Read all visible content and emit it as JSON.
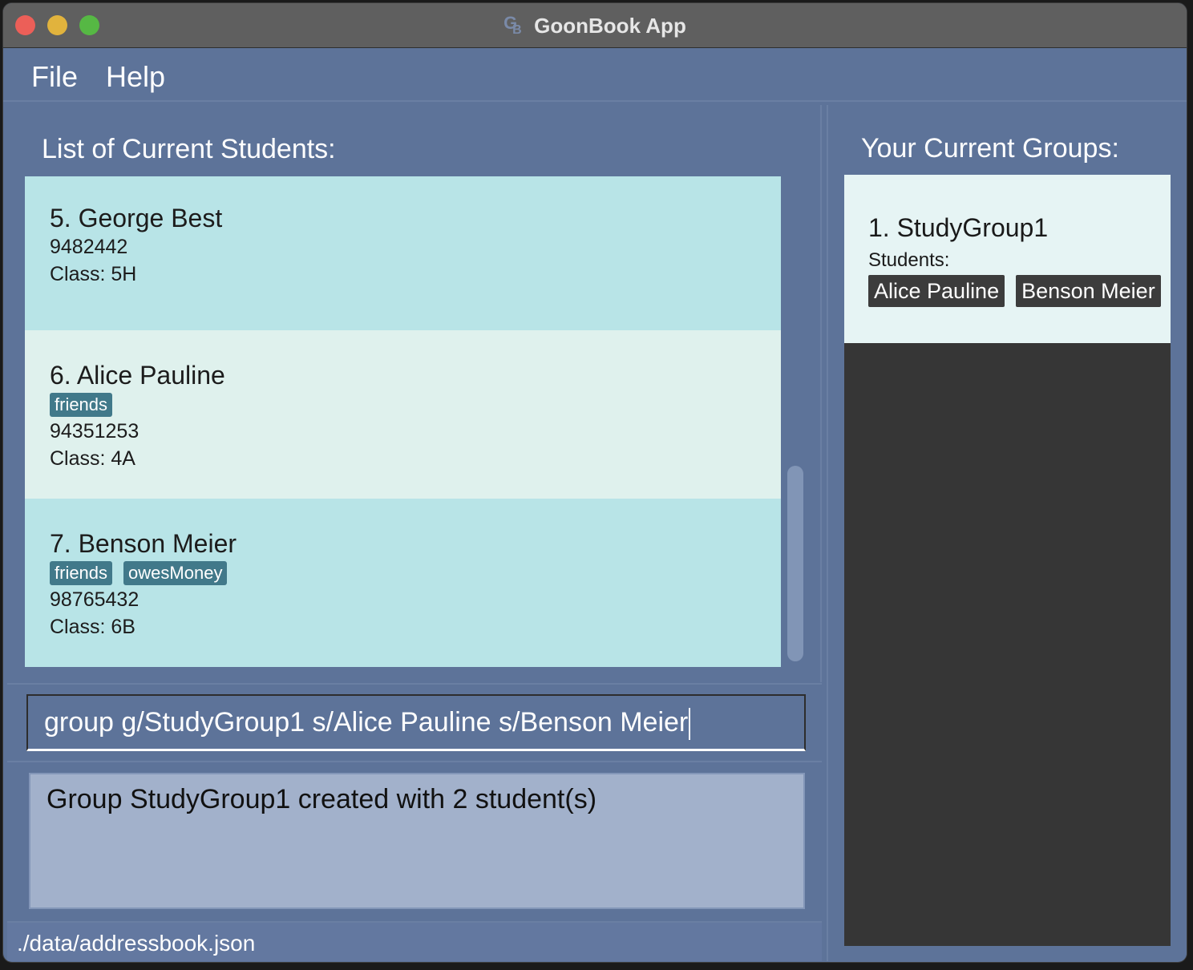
{
  "window": {
    "title": "GoonBook App",
    "app_icon": "goonbook-logo-icon"
  },
  "menu": {
    "file_label": "File",
    "help_label": "Help"
  },
  "students_panel": {
    "header": "List of Current Students:",
    "students": [
      {
        "title": "5. George Best",
        "tags": [],
        "phone": "9482442",
        "class_label": "Class: 5H"
      },
      {
        "title": "6. Alice Pauline",
        "tags": [
          "friends"
        ],
        "phone": "94351253",
        "class_label": "Class: 4A"
      },
      {
        "title": "7. Benson Meier",
        "tags": [
          "friends",
          "owesMoney"
        ],
        "phone": "98765432",
        "class_label": "Class: 6B"
      }
    ]
  },
  "command": {
    "value": "group g/StudyGroup1 s/Alice Pauline s/Benson Meier"
  },
  "result": {
    "text": "Group StudyGroup1 created with 2 student(s)"
  },
  "status": {
    "file_path": "./data/addressbook.json"
  },
  "groups_panel": {
    "header": "Your Current Groups:",
    "groups": [
      {
        "title": "1. StudyGroup1",
        "students_label": "Students:",
        "members": [
          "Alice Pauline",
          "Benson Meier"
        ]
      }
    ]
  },
  "colors": {
    "window_background": "#5d7399",
    "card_primary": "#b8e4e7",
    "card_secondary": "#dff1ed",
    "tag": "#41798a",
    "result_box": "#a2b1cb",
    "groups_background": "#363636",
    "group_card": "#e6f4f4",
    "member_tag": "#3c3c3c"
  }
}
